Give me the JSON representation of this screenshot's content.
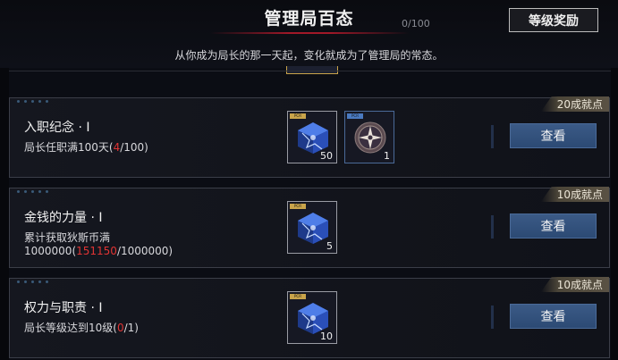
{
  "header": {
    "title": "管理局百态",
    "progress": "0/100",
    "reward_button": "等级奖励",
    "subtitle": "从你成为局长的那一天起，变化就成为了管理局的常态。"
  },
  "cards": [
    {
      "title": "入职纪念 · Ⅰ",
      "desc_prefix": "局长任职满100天(",
      "desc_current": "4",
      "desc_suffix": "/100)",
      "points": "20成就点",
      "rewards": [
        {
          "icon": "blue-crystal-cube-icon",
          "tag": "PCR",
          "qty": "50"
        },
        {
          "icon": "compass-emblem-icon",
          "tag": "PCR",
          "qty": "1"
        }
      ],
      "button": "查看"
    },
    {
      "title": "金钱的力量 · Ⅰ",
      "desc_line1": "累计获取狄斯币满",
      "desc_prefix": "1000000(",
      "desc_current": "151150",
      "desc_suffix": "/1000000)",
      "points": "10成就点",
      "rewards": [
        {
          "icon": "blue-crystal-cube-icon",
          "tag": "PCR",
          "qty": "5"
        }
      ],
      "button": "查看"
    },
    {
      "title": "权力与职责 · Ⅰ",
      "desc_prefix": "局长等级达到10级(",
      "desc_current": "0",
      "desc_suffix": "/1)",
      "points": "10成就点",
      "rewards": [
        {
          "icon": "blue-crystal-cube-icon",
          "tag": "PCR",
          "qty": "10"
        }
      ],
      "button": "查看"
    }
  ],
  "colors": {
    "highlight": "#e03434",
    "view_button": "#2c4a74",
    "gold_border": "#c9a44a"
  }
}
